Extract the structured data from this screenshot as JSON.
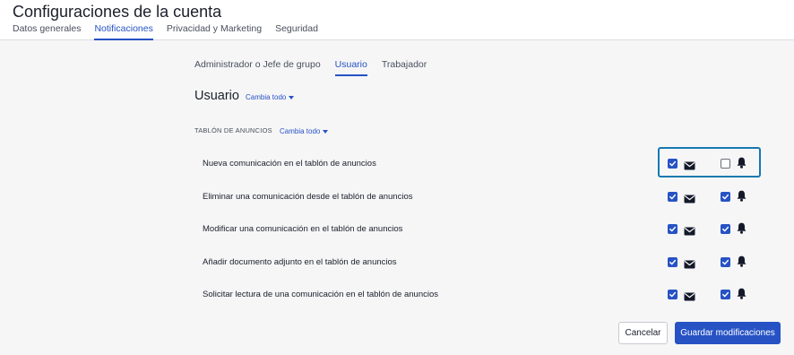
{
  "header": {
    "title": "Configuraciones de la cuenta",
    "tabs": [
      {
        "label": "Datos generales",
        "active": false
      },
      {
        "label": "Notificaciones",
        "active": true
      },
      {
        "label": "Privacidad y Marketing",
        "active": false
      },
      {
        "label": "Seguridad",
        "active": false
      }
    ]
  },
  "subtabs": [
    {
      "label": "Administrador o Jefe de grupo",
      "active": false
    },
    {
      "label": "Usuario",
      "active": true
    },
    {
      "label": "Trabajador",
      "active": false
    }
  ],
  "section": {
    "title": "Usuario",
    "change_all": "Cambia todo"
  },
  "group": {
    "title": "TABLÓN DE ANUNCIOS",
    "change_all": "Cambia todo"
  },
  "rows": [
    {
      "label": "Nueva comunicación en el tablón de anuncios",
      "email_checked": true,
      "push_checked": false
    },
    {
      "label": "Eliminar una comunicación desde el tablón de anuncios",
      "email_checked": true,
      "push_checked": true
    },
    {
      "label": "Modificar una comunicación en el tablón de anuncios",
      "email_checked": true,
      "push_checked": true
    },
    {
      "label": "Añadir documento adjunto en el tablón de anuncios",
      "email_checked": true,
      "push_checked": true
    },
    {
      "label": "Solicitar lectura de una comunicación en el tablón de anuncios",
      "email_checked": true,
      "push_checked": true
    }
  ],
  "icons": {
    "email": "envelope-icon",
    "push": "bell-icon"
  },
  "buttons": {
    "cancel": "Cancelar",
    "save": "Guardar modificaciones"
  },
  "colors": {
    "accent": "#2652c4",
    "highlight": "#1679b0"
  }
}
